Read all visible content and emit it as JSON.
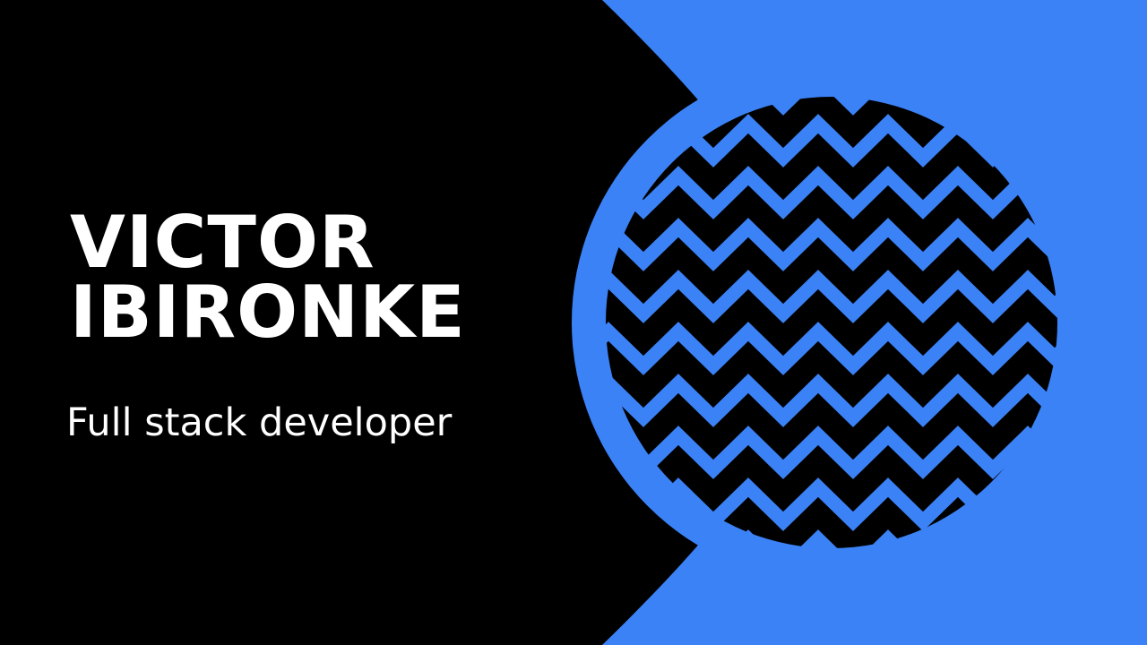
{
  "title": {
    "line1": "VICTOR",
    "line2": "IBIRONKE"
  },
  "subtitle": "Full stack developer",
  "colors": {
    "background_dark": "#000000",
    "accent_blue": "#3b82f6",
    "text": "#ffffff"
  },
  "decoration": {
    "pattern": "zigzag-chevron",
    "pattern_icon": "zigzag-circle-icon"
  }
}
